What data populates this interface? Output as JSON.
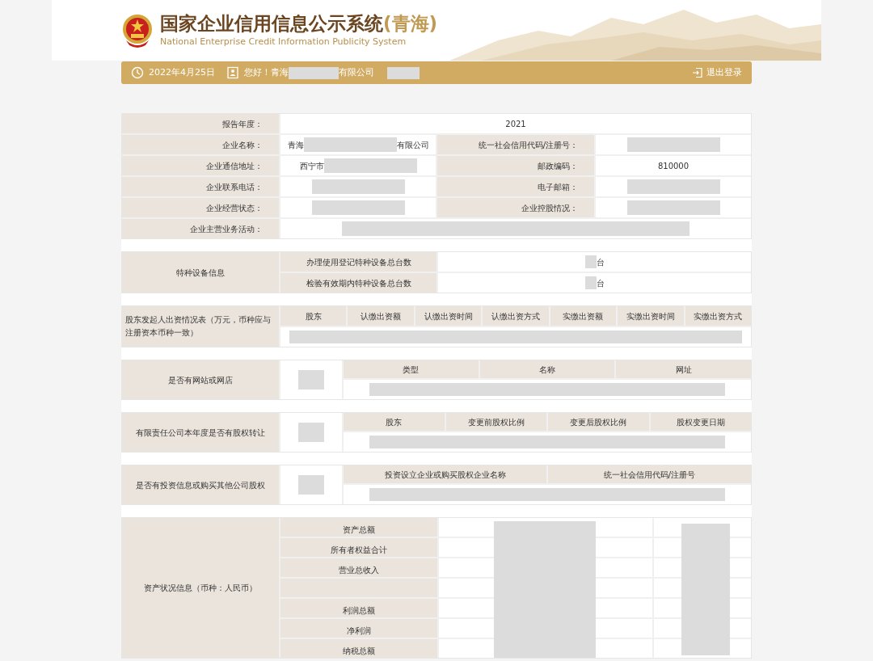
{
  "header": {
    "title": "国家企业信用信息公示系统",
    "region": "(青海)",
    "subtitle": "National Enterprise Credit Information Publicity System"
  },
  "toolbar": {
    "date": "2022年4月25日",
    "greeting_prefix": "您好！青海",
    "greeting_suffix": "有限公司",
    "logout": "退出登录"
  },
  "basic_info": [
    {
      "cells": [
        {
          "label": "报告年度：",
          "parts": [
            {
              "kind": "text",
              "text": "2021"
            }
          ]
        }
      ]
    },
    {
      "cells": [
        {
          "label": "企业名称：",
          "parts": [
            {
              "kind": "text",
              "text": "青海"
            },
            {
              "kind": "redacted"
            },
            {
              "kind": "text",
              "text": "有限公司"
            }
          ]
        },
        {
          "label": "统一社会信用代码/注册号：",
          "parts": [
            {
              "kind": "redacted"
            }
          ]
        }
      ]
    },
    {
      "cells": [
        {
          "label": "企业通信地址：",
          "parts": [
            {
              "kind": "text",
              "text": "西宁市"
            },
            {
              "kind": "redacted"
            }
          ]
        },
        {
          "label": "邮政编码：",
          "parts": [
            {
              "kind": "text",
              "text": "810000"
            }
          ]
        }
      ]
    },
    {
      "cells": [
        {
          "label": "企业联系电话：",
          "parts": [
            {
              "kind": "redacted"
            }
          ]
        },
        {
          "label": "电子邮箱：",
          "parts": [
            {
              "kind": "redacted"
            }
          ]
        }
      ]
    },
    {
      "cells": [
        {
          "label": "企业经营状态：",
          "parts": [
            {
              "kind": "redacted"
            }
          ]
        },
        {
          "label": "企业控股情况：",
          "parts": [
            {
              "kind": "redacted"
            }
          ]
        }
      ]
    },
    {
      "cells": [
        {
          "label": "企业主营业务活动：",
          "parts": [
            {
              "kind": "redacted"
            }
          ]
        }
      ]
    }
  ],
  "special_equipment": {
    "label": "特种设备信息",
    "rows": [
      {
        "label": "办理使用登记特种设备总台数",
        "unit": "台"
      },
      {
        "label": "检验有效期内特种设备总台数",
        "unit": "台"
      }
    ]
  },
  "shareholders": {
    "label": "股东发起人出资情况表（万元，币种应与注册资本币种一致）",
    "columns": [
      "股东",
      "认缴出资额",
      "认缴出资时间",
      "认缴出资方式",
      "实缴出资额",
      "实缴出资时间",
      "实缴出资方式"
    ]
  },
  "yes_no_sections": [
    {
      "label": "是否有网站或网店",
      "columns": [
        "类型",
        "名称",
        "网址"
      ]
    },
    {
      "label": "有限责任公司本年度是否有股权转让",
      "columns": [
        "股东",
        "变更前股权比例",
        "变更后股权比例",
        "股权变更日期"
      ]
    },
    {
      "label": "是否有投资信息或购买其他公司股权",
      "columns": [
        "投资设立企业或购买股权企业名称",
        "统一社会信用代码/注册号"
      ]
    }
  ],
  "assets": {
    "label": "资产状况信息（币种：人民币）",
    "items": [
      {
        "kind": "row",
        "label": "资产总额"
      },
      {
        "kind": "row",
        "label": "所有者权益合计"
      },
      {
        "kind": "row",
        "label": "营业总收入"
      },
      {
        "kind": "blank"
      },
      {
        "kind": "row",
        "label": "利润总额"
      },
      {
        "kind": "row",
        "label": "净利润"
      },
      {
        "kind": "row",
        "label": "纳税总额"
      }
    ]
  }
}
